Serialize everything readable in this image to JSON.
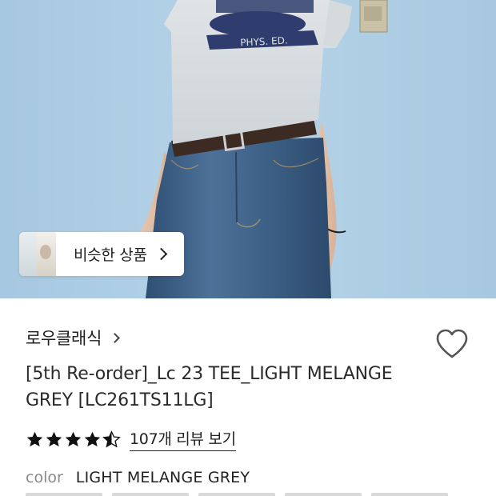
{
  "product_image": {
    "alt": ""
  },
  "similar": {
    "label": "비슷한 상품"
  },
  "brand": {
    "name": "로우클래식"
  },
  "product": {
    "title": "[5th Re-order]_Lc 23 TEE_LIGHT MELANGE GREY [LC261TS11LG]",
    "rating": 4.5,
    "reviews_label": "107개 리뷰 보기"
  },
  "option": {
    "key": "color",
    "value": "LIGHT MELANGE GREY"
  },
  "tee_print": {
    "banner": "PHYS. ED."
  },
  "colors": {
    "star": "#111111",
    "heart_stroke": "#555555",
    "wall": "#aecfe5",
    "denim": "#3d5f84"
  }
}
